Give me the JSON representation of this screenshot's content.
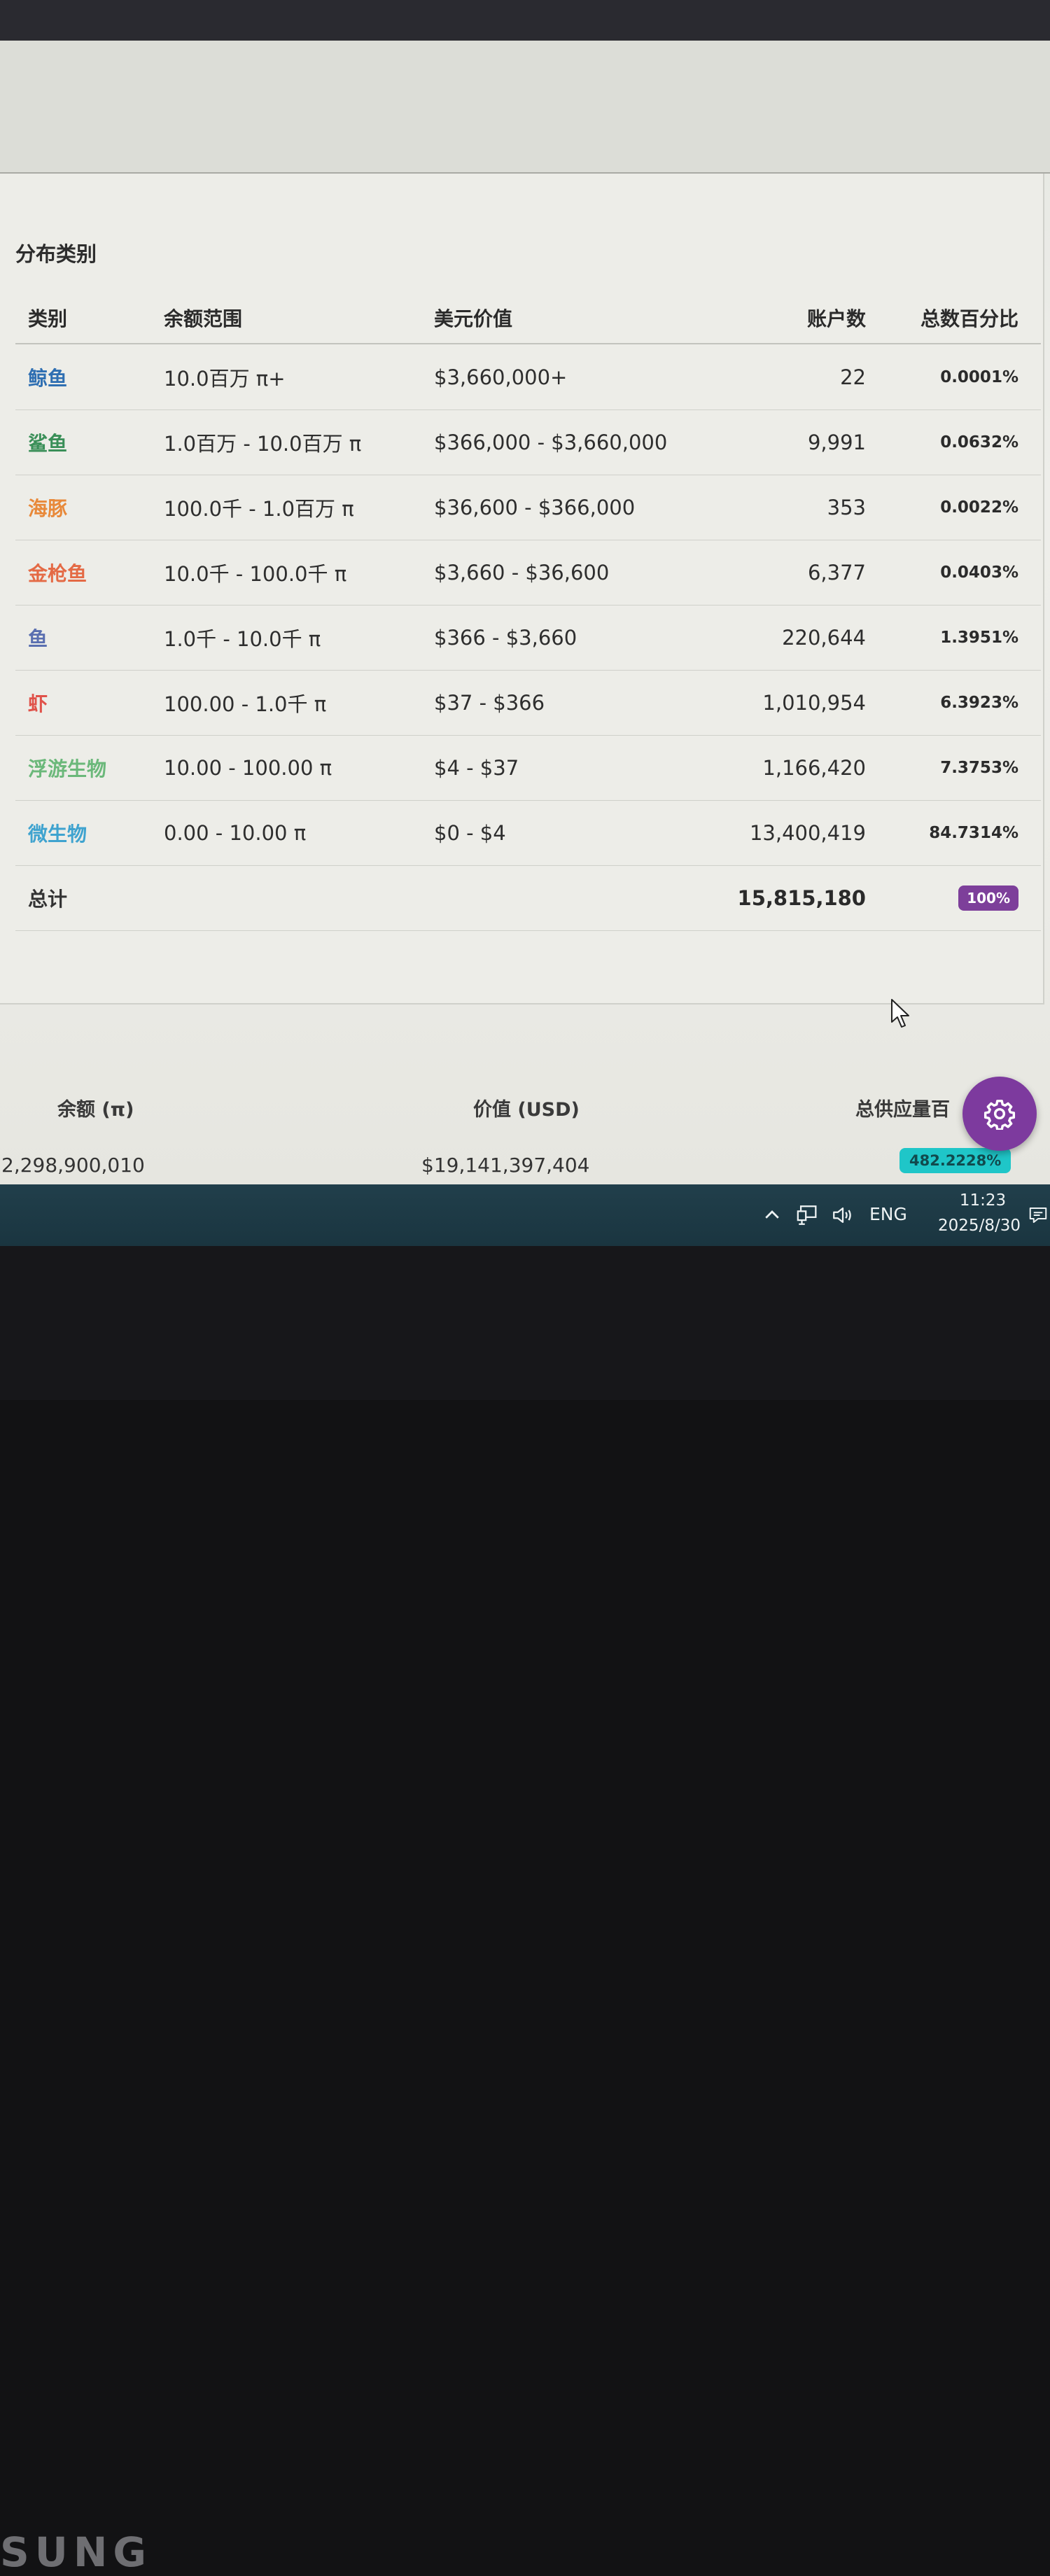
{
  "card": {
    "title": "分布类别",
    "headers": [
      "类别",
      "余额范围",
      "美元价值",
      "账户数",
      "总数百分比"
    ],
    "rows": [
      {
        "category": "鲸鱼",
        "color": "#2f6fb2",
        "range": "10.0百万 π+",
        "usd": "$3,660,000+",
        "accounts": "22",
        "percent": "0.0001%"
      },
      {
        "category": "鲨鱼",
        "color": "#3a8f58",
        "range": "1.0百万 - 10.0百万 π",
        "usd": "$366,000 - $3,660,000",
        "accounts": "9,991",
        "percent": "0.0632%"
      },
      {
        "category": "海豚",
        "color": "#e8893a",
        "range": "100.0千 - 1.0百万 π",
        "usd": "$36,600 - $366,000",
        "accounts": "353",
        "percent": "0.0022%"
      },
      {
        "category": "金枪鱼",
        "color": "#e46a45",
        "range": "10.0千 - 100.0千 π",
        "usd": "$3,660 - $36,600",
        "accounts": "6,377",
        "percent": "0.0403%"
      },
      {
        "category": "鱼",
        "color": "#5a6fb0",
        "range": "1.0千 - 10.0千 π",
        "usd": "$366 - $3,660",
        "accounts": "220,644",
        "percent": "1.3951%"
      },
      {
        "category": "虾",
        "color": "#e0524a",
        "range": "100.00 - 1.0千 π",
        "usd": "$37 - $366",
        "accounts": "1,010,954",
        "percent": "6.3923%"
      },
      {
        "category": "浮游生物",
        "color": "#6bb87a",
        "range": "10.00 - 100.00 π",
        "usd": "$4 - $37",
        "accounts": "1,166,420",
        "percent": "7.3753%"
      },
      {
        "category": "微生物",
        "color": "#3fa3cf",
        "range": "0.00 - 10.00 π",
        "usd": "$0 - $4",
        "accounts": "13,400,419",
        "percent": "84.7314%"
      }
    ],
    "total": {
      "label": "总计",
      "accounts": "15,815,180",
      "percent": "100%"
    }
  },
  "summary": {
    "balance_label": "余额 (π)",
    "value_label": "价值 (USD)",
    "supply_label": "总供应量百",
    "balance_value": "2,298,900,010",
    "value_value": "$19,141,397,404",
    "supply_value": "482.2228%"
  },
  "taskbar": {
    "language": "ENG",
    "time": "11:23",
    "date": "2025/8/30"
  },
  "monitor": {
    "brand": "SUNG"
  },
  "icons": [
    "settings-gear-icon",
    "mouse-cursor-icon",
    "chevron-up-icon",
    "network-icon",
    "volume-icon",
    "notification-icon"
  ]
}
